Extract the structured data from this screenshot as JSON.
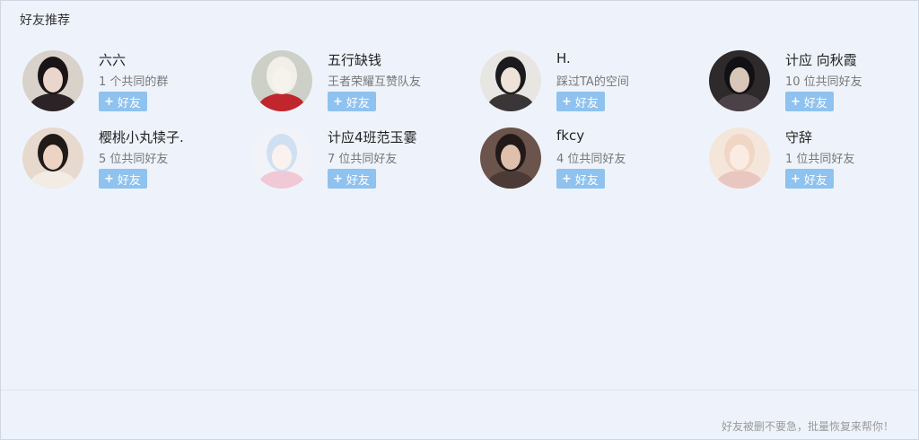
{
  "panel": {
    "title": "好友推荐",
    "footer_link": "好友被删不要急，批量恢复来帮你！",
    "add_label": "好友",
    "add_icon": "plus-icon"
  },
  "friends": [
    {
      "name": "六六",
      "sub": "1 个共同的群",
      "avatar": {
        "bg": "#d9d2cb",
        "hair": "#1a1416",
        "skin": "#ead6cc",
        "cloth": "#2b2325"
      }
    },
    {
      "name": "五行缺钱",
      "sub": "王者荣耀互赞队友",
      "avatar": {
        "bg": "#cdd0c6",
        "hair": "#f2efe9",
        "skin": "#f6f2ec",
        "cloth": "#c0262c"
      }
    },
    {
      "name": "H.",
      "sub": "踩过TA的空间",
      "avatar": {
        "bg": "#e8e6e3",
        "hair": "#1b1a1c",
        "skin": "#efe2d8",
        "cloth": "#3a3638"
      }
    },
    {
      "name": "计应 向秋霞",
      "sub": "10 位共同好友",
      "avatar": {
        "bg": "#2e2a2c",
        "hair": "#111014",
        "skin": "#d8c6b8",
        "cloth": "#4a4246"
      }
    },
    {
      "name": "樱桃小丸犊子.",
      "sub": "5 位共同好友",
      "avatar": {
        "bg": "#e7d9cd",
        "hair": "#201a18",
        "skin": "#ecd3c3",
        "cloth": "#f3ece5"
      }
    },
    {
      "name": "计应4班范玉霎",
      "sub": "7 位共同好友",
      "avatar": {
        "bg": "#f1f3f8",
        "hair": "#cfe0f3",
        "skin": "#fbf2ef",
        "cloth": "#f0c8d6"
      }
    },
    {
      "name": "fkcy",
      "sub": "4 位共同好友",
      "avatar": {
        "bg": "#6b544b",
        "hair": "#221a18",
        "skin": "#dfc0ad",
        "cloth": "#4b3a35"
      }
    },
    {
      "name": "守辞",
      "sub": "1 位共同好友",
      "avatar": {
        "bg": "#f5e6dc",
        "hair": "#f0d6c4",
        "skin": "#fbece3",
        "cloth": "#e8c7c0"
      }
    }
  ]
}
